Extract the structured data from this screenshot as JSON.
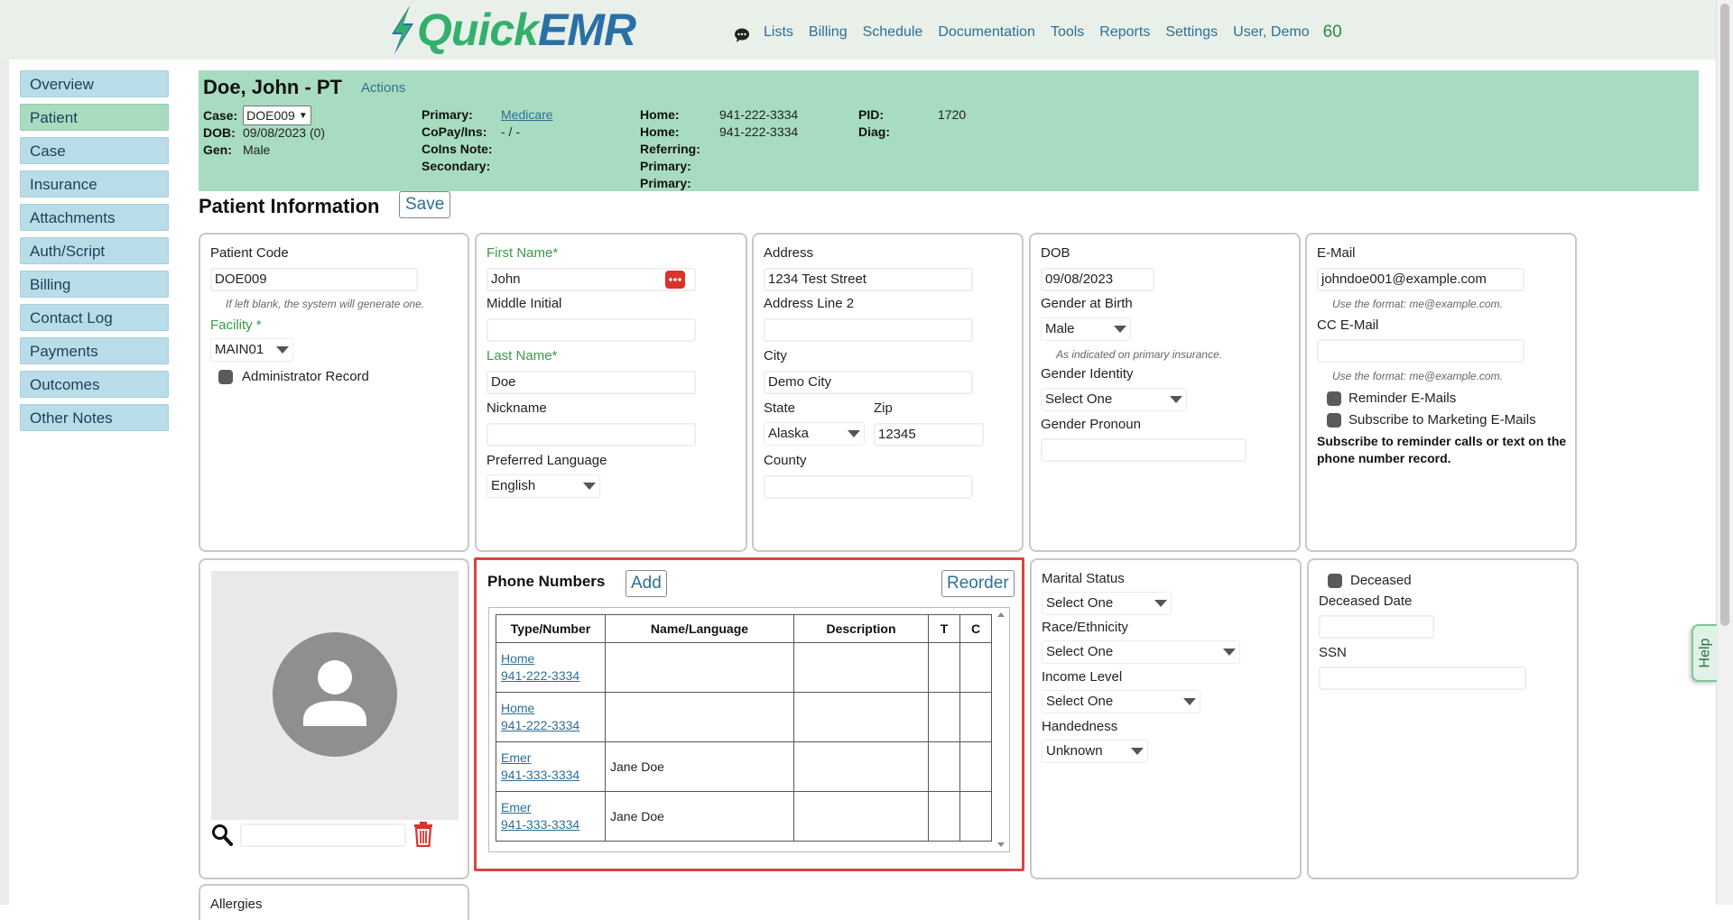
{
  "app": {
    "logo_quick": "Quick",
    "logo_emr": "EMR"
  },
  "topnav": {
    "items": [
      "Lists",
      "Billing",
      "Schedule",
      "Documentation",
      "Tools",
      "Reports",
      "Settings",
      "User, Demo"
    ],
    "count": "60"
  },
  "sidebar": {
    "items": [
      {
        "label": "Overview"
      },
      {
        "label": "Patient"
      },
      {
        "label": "Case"
      },
      {
        "label": "Insurance"
      },
      {
        "label": "Attachments"
      },
      {
        "label": "Auth/Script"
      },
      {
        "label": "Billing"
      },
      {
        "label": "Contact Log"
      },
      {
        "label": "Payments"
      },
      {
        "label": "Outcomes"
      },
      {
        "label": "Other Notes"
      }
    ],
    "active_index": 1
  },
  "header": {
    "patient_name": "Doe, John - PT",
    "actions": "Actions",
    "case_label": "Case:",
    "case_value": "DOE009",
    "dob_label": "DOB:",
    "dob_value": "09/08/2023 (0)",
    "gen_label": "Gen:",
    "gen_value": "Male",
    "primary_label": "Primary:",
    "primary_value": "Medicare",
    "copay_label": "CoPay/Ins:",
    "copay_value": "- / -",
    "coins_label": "CoIns Note:",
    "secondary_label": "Secondary:",
    "home1_label": "Home:",
    "home1_value": "941-222-3334",
    "home2_label": "Home:",
    "home2_value": "941-222-3334",
    "referring_label": "Referring:",
    "primary2_label": "Primary:",
    "primary3_label": "Primary:",
    "pid_label": "PID:",
    "pid_value": "1720",
    "diag_label": "Diag:"
  },
  "page": {
    "title": "Patient Information",
    "save": "Save",
    "help": "Help"
  },
  "card1": {
    "patient_code_label": "Patient Code",
    "patient_code_value": "DOE009",
    "patient_code_hint": "If left blank, the system will generate one.",
    "facility_label": "Facility *",
    "facility_value": "MAIN01",
    "admin_label": "Administrator Record"
  },
  "card2": {
    "first_name_label": "First Name*",
    "first_name_value": "John",
    "middle_label": "Middle Initial",
    "middle_value": "",
    "last_name_label": "Last Name*",
    "last_name_value": "Doe",
    "nickname_label": "Nickname",
    "nickname_value": "",
    "language_label": "Preferred Language",
    "language_value": "English"
  },
  "card3": {
    "address_label": "Address",
    "address_value": "1234 Test Street",
    "address2_label": "Address Line 2",
    "address2_value": "",
    "city_label": "City",
    "city_value": "Demo City",
    "state_label": "State",
    "state_value": "Alaska",
    "zip_label": "Zip",
    "zip_value": "12345",
    "county_label": "County",
    "county_value": ""
  },
  "card4": {
    "dob_label": "DOB",
    "dob_value": "09/08/2023",
    "gender_birth_label": "Gender at Birth",
    "gender_birth_value": "Male",
    "gender_birth_hint": "As indicated on primary insurance.",
    "gender_identity_label": "Gender Identity",
    "gender_identity_value": "Select One",
    "pronoun_label": "Gender Pronoun",
    "pronoun_value": ""
  },
  "card5": {
    "email_label": "E-Mail",
    "email_value": "johndoe001@example.com",
    "email_hint": "Use the format: me@example.com.",
    "cc_label": "CC E-Mail",
    "cc_value": "",
    "cc_hint": "Use the format: me@example.com.",
    "reminder_label": "Reminder E-Mails",
    "marketing_label": "Subscribe to Marketing E-Mails",
    "subscribe_note": "Subscribe to reminder calls or text on the phone number record."
  },
  "photo": {
    "search_value": ""
  },
  "phones": {
    "title": "Phone Numbers",
    "add": "Add",
    "reorder": "Reorder",
    "columns": [
      "Type/Number",
      "Name/Language",
      "Description",
      "T",
      "C"
    ],
    "rows": [
      {
        "type": "Home",
        "number": "941-222-3334",
        "name": "",
        "description": "",
        "t": "",
        "c": ""
      },
      {
        "type": "Home",
        "number": "941-222-3334",
        "name": "",
        "description": "",
        "t": "",
        "c": ""
      },
      {
        "type": "Emer",
        "number": "941-333-3334",
        "name": "Jane Doe",
        "description": "",
        "t": "",
        "c": ""
      },
      {
        "type": "Emer",
        "number": "941-333-3334",
        "name": "Jane Doe",
        "description": "",
        "t": "",
        "c": ""
      }
    ]
  },
  "card7": {
    "marital_label": "Marital Status",
    "marital_value": "Select One",
    "race_label": "Race/Ethnicity",
    "race_value": "Select One",
    "income_label": "Income Level",
    "income_value": "Select One",
    "handedness_label": "Handedness",
    "handedness_value": "Unknown"
  },
  "card8": {
    "deceased_label": "Deceased",
    "deceased_date_label": "Deceased Date",
    "deceased_date_value": "",
    "ssn_label": "SSN",
    "ssn_value": ""
  },
  "allergies": {
    "label": "Allergies"
  },
  "colors": {
    "brand_green": "#33b16c",
    "brand_blue": "#2a6fa6",
    "header_bg": "#a8dcc0",
    "nav_bg": "#b9dde8",
    "highlight_red": "#d94545"
  }
}
